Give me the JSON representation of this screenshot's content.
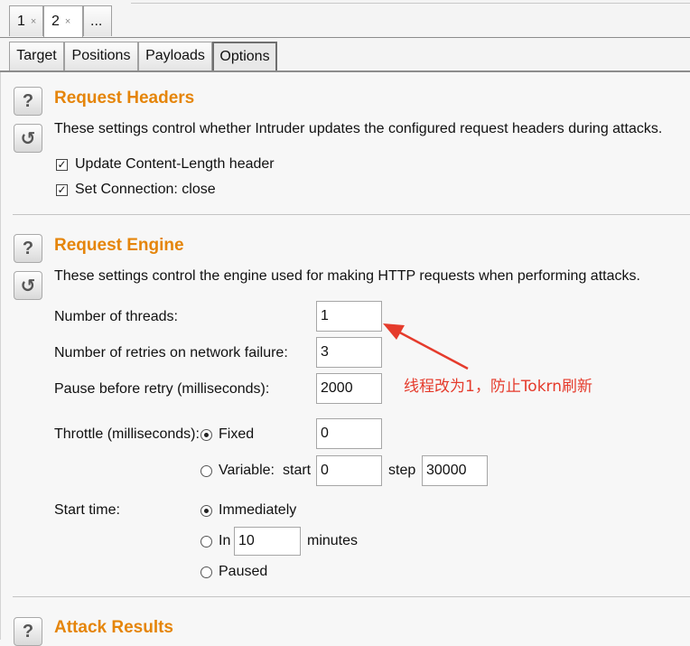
{
  "request_tabs": [
    {
      "label": "1",
      "close": "×"
    },
    {
      "label": "2",
      "close": "×"
    },
    {
      "label": "..."
    }
  ],
  "sub_tabs": [
    "Target",
    "Positions",
    "Payloads",
    "Options"
  ],
  "active_sub_tab": "Options",
  "icons": {
    "help": "?",
    "restore": "↺"
  },
  "request_headers": {
    "title": "Request Headers",
    "description": "These settings control whether Intruder updates the configured request headers during attacks.",
    "options": [
      {
        "label": "Update Content-Length header",
        "checked": true
      },
      {
        "label": "Set Connection: close",
        "checked": true
      }
    ]
  },
  "request_engine": {
    "title": "Request Engine",
    "description": "These settings control the engine used for making HTTP requests when performing attacks.",
    "threads_label": "Number of threads:",
    "threads_value": "1",
    "retries_label": "Number of retries on network failure:",
    "retries_value": "3",
    "pause_label": "Pause before retry (milliseconds):",
    "pause_value": "2000",
    "throttle_label": "Throttle (milliseconds):",
    "throttle_fixed_label": "Fixed",
    "throttle_fixed_value": "0",
    "throttle_variable_label": "Variable:",
    "throttle_start_label": "start",
    "throttle_start_value": "0",
    "throttle_step_label": "step",
    "throttle_step_value": "30000",
    "start_time_label": "Start time:",
    "start_immediately_label": "Immediately",
    "start_in_label": "In",
    "start_in_value": "10",
    "start_minutes_label": "minutes",
    "start_paused_label": "Paused",
    "throttle_mode": "Fixed",
    "start_mode": "Immediately"
  },
  "attack_results": {
    "title": "Attack Results"
  },
  "annotation": {
    "text": "线程改为1，防止Tokrn刷新",
    "color": "#e53b2c"
  },
  "colors": {
    "section_title": "#e5850a"
  }
}
